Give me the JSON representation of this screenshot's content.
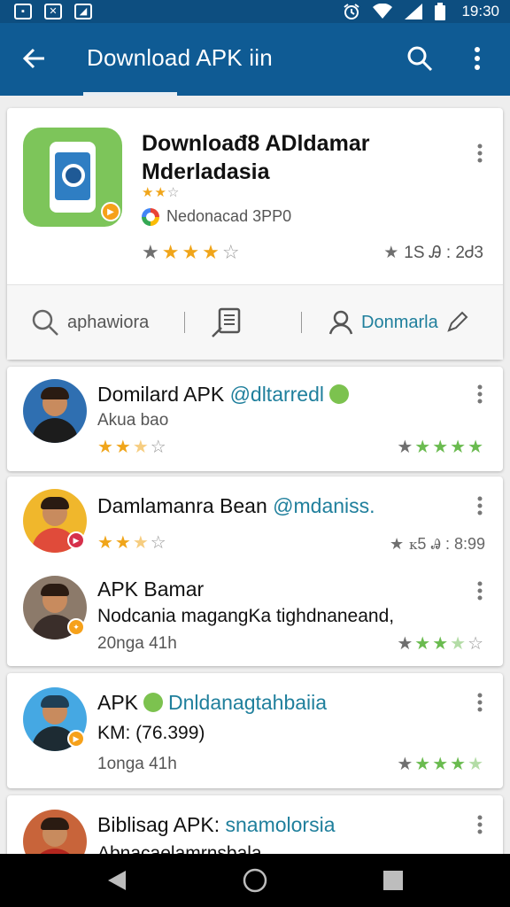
{
  "status_bar": {
    "time": "19:30",
    "left_icons": [
      "notification-icon",
      "image-notification-icon",
      "download-notification-icon"
    ],
    "right_icons": [
      "alarm-icon",
      "wifi-icon",
      "signal-icon",
      "battery-icon"
    ]
  },
  "app_bar": {
    "title": "Download APK iin",
    "icons": {
      "back": "arrow-left-icon",
      "search": "search-icon",
      "more": "more-vertical-icon"
    },
    "background": "#0f5b94"
  },
  "hero": {
    "title_line1": "Downloađ8 ADldamar",
    "title_line2": "Mderladasia",
    "mini_rating": {
      "filled": 2,
      "total": 3
    },
    "developer": "Nedonacad 3PP0",
    "rating": {
      "filled": 3,
      "total": 5
    },
    "stat": "1S Ꭿ : 2Ꮷ3",
    "icon_color": "#7dc55a"
  },
  "toolbar": {
    "search_label": "aphawiora",
    "account_label": "Donmarla",
    "accent": "#1f7f9c"
  },
  "feed": [
    {
      "title": "Domilard APK",
      "handle": "@dltarredl",
      "subtitle": "Akua bao",
      "rating": {
        "filled": 2.5,
        "total": 5
      },
      "right_rating": {
        "filled": 4,
        "total": 5
      }
    },
    {
      "title": "Damlamanra Bean",
      "handle": "@mdaniss.",
      "rating": {
        "filled": 2.5,
        "total": 5
      },
      "stat": "ꮶ5 Ꭿ : 8:99"
    },
    {
      "title": "APK Bamar",
      "body": "Nodcania magangKa tighdnaneand,",
      "time": "20nga 41h",
      "right_rating": {
        "filled": 2.5,
        "total": 5
      }
    },
    {
      "title": "APK",
      "handle": "Dnldanagtahbaiia",
      "body": "KM: (76.399)",
      "time": "1onga 41h",
      "right_rating": {
        "filled": 3.5,
        "total": 5
      }
    },
    {
      "title": "Biblisag APK:",
      "handle": "snamolorsia",
      "body": "Abnacaelamrnsbala"
    }
  ],
  "nav_bar": {
    "icons": [
      "back-triangle-icon",
      "home-circle-icon",
      "recents-square-icon"
    ]
  },
  "colors": {
    "star_gold": "#f0a51a",
    "star_green": "#6abb4f",
    "star_grey": "#9a9a9a"
  }
}
